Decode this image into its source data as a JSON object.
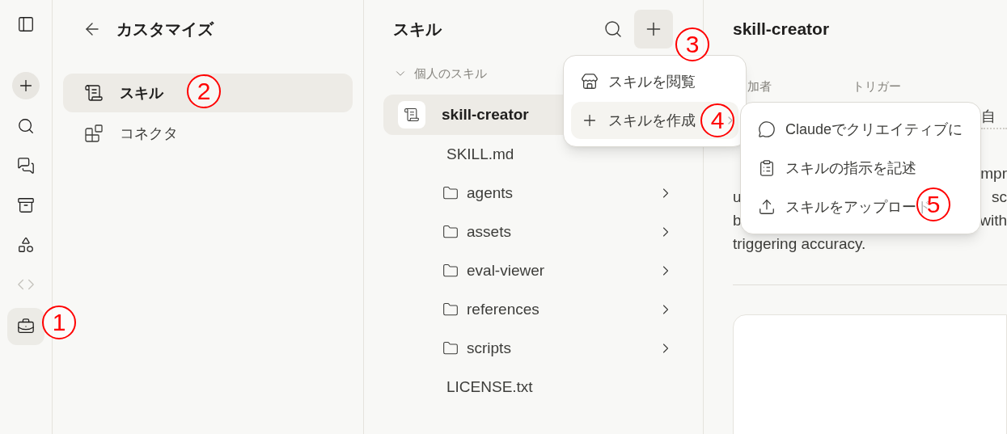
{
  "rail": {
    "items": [
      {
        "kind": "toggle",
        "selected": false
      },
      {
        "kind": "new",
        "selected": false
      },
      {
        "kind": "search",
        "selected": false
      },
      {
        "kind": "chats",
        "selected": false
      },
      {
        "kind": "projects",
        "selected": false
      },
      {
        "kind": "artifacts",
        "selected": false
      },
      {
        "kind": "code",
        "selected": false
      },
      {
        "kind": "toolbox",
        "selected": true
      }
    ]
  },
  "customize": {
    "title": "カスタマイズ",
    "items": [
      {
        "kind": "skills",
        "label": "スキル",
        "selected": true
      },
      {
        "kind": "connectors",
        "label": "コネクタ",
        "selected": false
      }
    ]
  },
  "skills": {
    "title": "スキル",
    "section": "個人のスキル",
    "section_expanded": true,
    "items": [
      {
        "name": "skill-creator",
        "selected": true,
        "children": [
          {
            "kind": "file",
            "name": "SKILL.md"
          },
          {
            "kind": "folder",
            "name": "agents",
            "expanded": false
          },
          {
            "kind": "folder",
            "name": "assets",
            "expanded": false
          },
          {
            "kind": "folder",
            "name": "eval-viewer",
            "expanded": false
          },
          {
            "kind": "folder",
            "name": "references",
            "expanded": false
          },
          {
            "kind": "folder",
            "name": "scripts",
            "expanded": false
          },
          {
            "kind": "file",
            "name": "LICENSE.txt"
          }
        ]
      }
    ]
  },
  "detail": {
    "title": "skill-creator",
    "label_1": "加者",
    "label_2": "トリガー",
    "value_2": "自",
    "description_lines": [
      {
        "right": "mpr"
      },
      {
        "left": "u",
        "right": "sc"
      },
      {
        "left": "b",
        "right": "with"
      },
      {
        "left": "triggering accuracy."
      }
    ]
  },
  "add_menu": {
    "items": [
      {
        "kind": "browse",
        "label": "スキルを閲覧",
        "highlighted": false,
        "submenu": false
      },
      {
        "kind": "create",
        "label": "スキルを作成",
        "highlighted": true,
        "submenu": true
      }
    ]
  },
  "create_submenu": {
    "items": [
      {
        "kind": "chat",
        "label": "Claudeでクリエイティブに"
      },
      {
        "kind": "instructions",
        "label": "スキルの指示を記述"
      },
      {
        "kind": "upload",
        "label": "スキルをアップロード"
      }
    ]
  },
  "annotations": [
    {
      "text": "1"
    },
    {
      "text": "2"
    },
    {
      "text": "3"
    },
    {
      "text": "4"
    },
    {
      "text": "5"
    }
  ]
}
